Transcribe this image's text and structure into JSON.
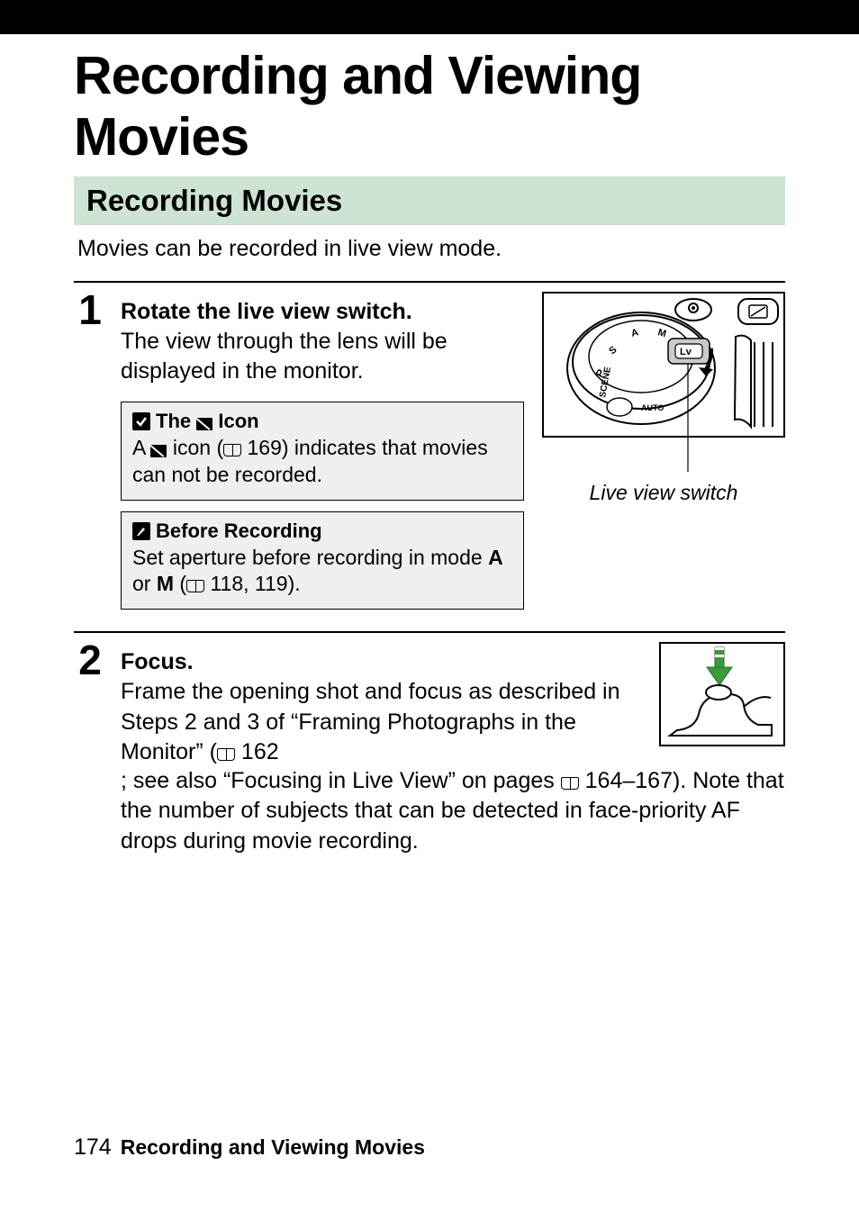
{
  "chapter_title": "Recording and Viewing Movies",
  "section_title": "Recording Movies",
  "intro": "Movies can be recorded in live view mode.",
  "step1": {
    "num": "1",
    "title": "Rotate the live view switch.",
    "para": "The view through the lens will be displayed in the monitor.",
    "illus_caption": "Live view switch",
    "callout_icon": {
      "prefix_word": "The ",
      "suffix_word": " Icon",
      "body_a": "A ",
      "body_b": " icon (",
      "body_ref": "169",
      "body_c": ") indicates that movies can not be recorded."
    },
    "callout_before": {
      "title": "Before Recording",
      "body_a": "Set aperture before recording in mode ",
      "body_b": " or ",
      "body_c": " (",
      "body_ref": "118, 119",
      "body_d": ").",
      "mode_a": "A",
      "mode_m": "M"
    }
  },
  "step2": {
    "num": "2",
    "title": "Focus.",
    "para_a": "Frame the opening shot and focus as described in Steps 2 and 3 of “Framing Photographs in the Monitor” (",
    "para_a_ref": "162",
    "para_a_tail": "; see also “Focusing in Live View” on pages ",
    "para_b_ref": "164–167",
    "para_tail": ").  Note that the number of subjects that can be detected in face-priority AF drops during movie recording."
  },
  "footer": {
    "page": "174",
    "title": "Recording and Viewing Movies"
  }
}
